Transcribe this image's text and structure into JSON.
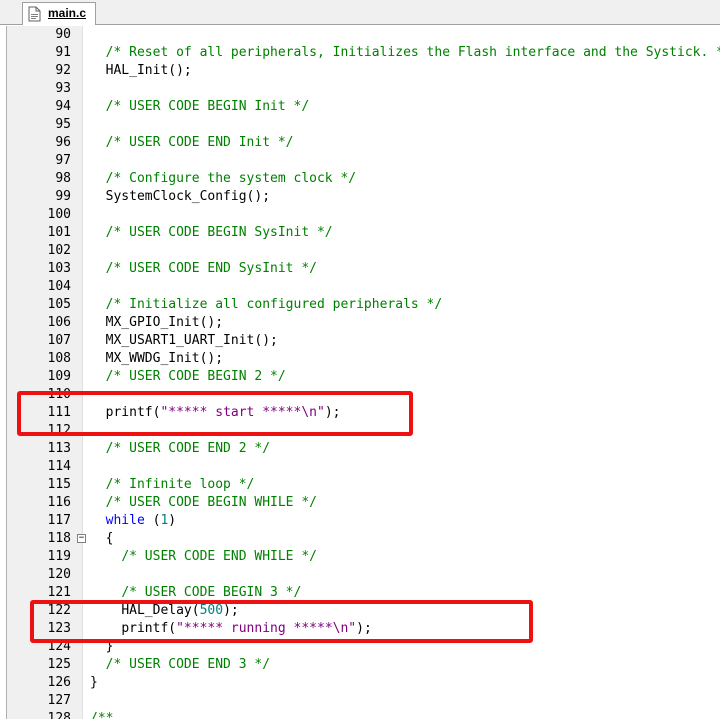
{
  "tab": {
    "label": "main.c"
  },
  "lines": [
    {
      "n": "90",
      "indent": "",
      "segs": []
    },
    {
      "n": "91",
      "indent": "  ",
      "segs": [
        {
          "t": "comment",
          "v": "/* Reset of all peripherals, Initializes the Flash interface and the Systick. */"
        }
      ]
    },
    {
      "n": "92",
      "indent": "  ",
      "segs": [
        {
          "t": "plain",
          "v": "HAL_Init();"
        }
      ]
    },
    {
      "n": "93",
      "indent": "",
      "segs": []
    },
    {
      "n": "94",
      "indent": "  ",
      "segs": [
        {
          "t": "comment",
          "v": "/* USER CODE BEGIN Init */"
        }
      ]
    },
    {
      "n": "95",
      "indent": "",
      "segs": []
    },
    {
      "n": "96",
      "indent": "  ",
      "segs": [
        {
          "t": "comment",
          "v": "/* USER CODE END Init */"
        }
      ]
    },
    {
      "n": "97",
      "indent": "",
      "segs": []
    },
    {
      "n": "98",
      "indent": "  ",
      "segs": [
        {
          "t": "comment",
          "v": "/* Configure the system clock */"
        }
      ]
    },
    {
      "n": "99",
      "indent": "  ",
      "segs": [
        {
          "t": "plain",
          "v": "SystemClock_Config();"
        }
      ]
    },
    {
      "n": "100",
      "indent": "",
      "segs": []
    },
    {
      "n": "101",
      "indent": "  ",
      "segs": [
        {
          "t": "comment",
          "v": "/* USER CODE BEGIN SysInit */"
        }
      ]
    },
    {
      "n": "102",
      "indent": "",
      "segs": []
    },
    {
      "n": "103",
      "indent": "  ",
      "segs": [
        {
          "t": "comment",
          "v": "/* USER CODE END SysInit */"
        }
      ]
    },
    {
      "n": "104",
      "indent": "",
      "segs": []
    },
    {
      "n": "105",
      "indent": "  ",
      "segs": [
        {
          "t": "comment",
          "v": "/* Initialize all configured peripherals */"
        }
      ]
    },
    {
      "n": "106",
      "indent": "  ",
      "segs": [
        {
          "t": "plain",
          "v": "MX_GPIO_Init();"
        }
      ]
    },
    {
      "n": "107",
      "indent": "  ",
      "segs": [
        {
          "t": "plain",
          "v": "MX_USART1_UART_Init();"
        }
      ]
    },
    {
      "n": "108",
      "indent": "  ",
      "segs": [
        {
          "t": "plain",
          "v": "MX_WWDG_Init();"
        }
      ]
    },
    {
      "n": "109",
      "indent": "  ",
      "segs": [
        {
          "t": "comment",
          "v": "/* USER CODE BEGIN 2 */"
        }
      ]
    },
    {
      "n": "110",
      "indent": "",
      "segs": []
    },
    {
      "n": "111",
      "indent": "  ",
      "segs": [
        {
          "t": "plain",
          "v": "printf("
        },
        {
          "t": "string",
          "v": "\"***** start *****\\n\""
        },
        {
          "t": "plain",
          "v": ");"
        }
      ]
    },
    {
      "n": "112",
      "indent": "",
      "segs": []
    },
    {
      "n": "113",
      "indent": "  ",
      "segs": [
        {
          "t": "comment",
          "v": "/* USER CODE END 2 */"
        }
      ]
    },
    {
      "n": "114",
      "indent": "",
      "segs": []
    },
    {
      "n": "115",
      "indent": "  ",
      "segs": [
        {
          "t": "comment",
          "v": "/* Infinite loop */"
        }
      ]
    },
    {
      "n": "116",
      "indent": "  ",
      "segs": [
        {
          "t": "comment",
          "v": "/* USER CODE BEGIN WHILE */"
        }
      ]
    },
    {
      "n": "117",
      "indent": "  ",
      "segs": [
        {
          "t": "keyword",
          "v": "while"
        },
        {
          "t": "plain",
          "v": " ("
        },
        {
          "t": "number",
          "v": "1"
        },
        {
          "t": "plain",
          "v": ")"
        }
      ]
    },
    {
      "n": "118",
      "indent": "  ",
      "fold": "−",
      "segs": [
        {
          "t": "plain",
          "v": "{"
        }
      ]
    },
    {
      "n": "119",
      "indent": "    ",
      "segs": [
        {
          "t": "comment",
          "v": "/* USER CODE END WHILE */"
        }
      ]
    },
    {
      "n": "120",
      "indent": "",
      "segs": []
    },
    {
      "n": "121",
      "indent": "    ",
      "segs": [
        {
          "t": "comment",
          "v": "/* USER CODE BEGIN 3 */"
        }
      ]
    },
    {
      "n": "122",
      "indent": "    ",
      "segs": [
        {
          "t": "plain",
          "v": "HAL_Delay("
        },
        {
          "t": "number",
          "v": "500"
        },
        {
          "t": "plain",
          "v": ");"
        }
      ]
    },
    {
      "n": "123",
      "indent": "    ",
      "segs": [
        {
          "t": "plain",
          "v": "printf("
        },
        {
          "t": "string",
          "v": "\"***** running *****\\n\""
        },
        {
          "t": "plain",
          "v": ");"
        }
      ]
    },
    {
      "n": "124",
      "indent": "  ",
      "segs": [
        {
          "t": "plain",
          "v": "}"
        }
      ]
    },
    {
      "n": "125",
      "indent": "  ",
      "segs": [
        {
          "t": "comment",
          "v": "/* USER CODE END 3 */"
        }
      ]
    },
    {
      "n": "126",
      "indent": "",
      "segs": [
        {
          "t": "plain",
          "v": "}"
        }
      ]
    },
    {
      "n": "127",
      "indent": "",
      "segs": []
    },
    {
      "n": "128",
      "indent": "",
      "segs": [
        {
          "t": "comment",
          "v": "/**"
        }
      ]
    }
  ],
  "colors": {
    "comment": "#008000",
    "string": "#800080",
    "number": "#008080",
    "keyword": "#0000ff",
    "highlight": "#ee1111"
  }
}
